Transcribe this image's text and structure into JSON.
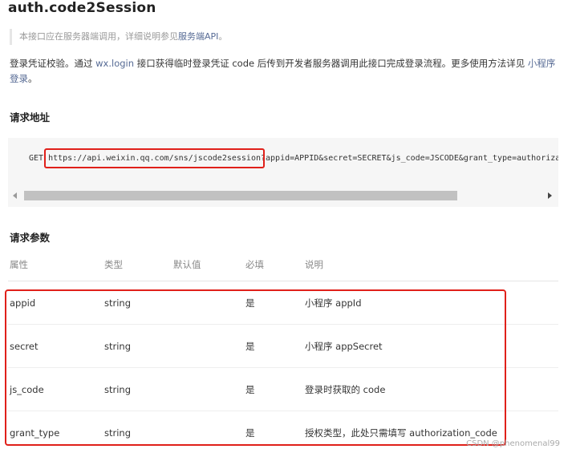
{
  "title": "auth.code2Session",
  "note": {
    "text": "本接口应在服务器端调用，详细说明参见",
    "link": "服务端API",
    "end": "。"
  },
  "description": {
    "part1": "登录凭证校验。通过 ",
    "link1": "wx.login",
    "part2": " 接口获得临时登录凭证 code 后传到开发者服务器调用此接口完成登录流程。更多使用方法详见 ",
    "link2": "小程序登录",
    "end": "。"
  },
  "request_url": {
    "heading": "请求地址",
    "method": "GET",
    "url": "https://api.weixin.qq.com/sns/jscode2session",
    "query": "?appid=APPID&secret=SECRET&js_code=JSCODE&grant_type=authorization_code"
  },
  "params": {
    "heading": "请求参数",
    "columns": [
      "属性",
      "类型",
      "默认值",
      "必填",
      "说明"
    ],
    "rows": [
      {
        "name": "appid",
        "type": "string",
        "default": "",
        "required": "是",
        "desc": "小程序 appId"
      },
      {
        "name": "secret",
        "type": "string",
        "default": "",
        "required": "是",
        "desc": "小程序 appSecret"
      },
      {
        "name": "js_code",
        "type": "string",
        "default": "",
        "required": "是",
        "desc": "登录时获取的 code"
      },
      {
        "name": "grant_type",
        "type": "string",
        "default": "",
        "required": "是",
        "desc": "授权类型，此处只需填写 authorization_code"
      }
    ]
  },
  "watermark": "CSDN @phenomenal99",
  "colors": {
    "link": "#576b95",
    "highlight": "#e0201a",
    "code_bg": "#f6f6f6"
  }
}
